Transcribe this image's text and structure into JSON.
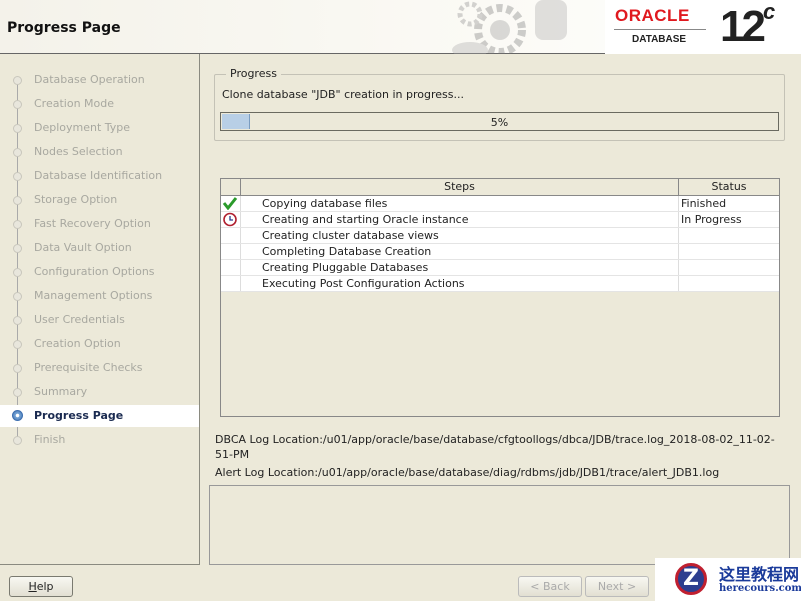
{
  "header": {
    "title": "Progress Page",
    "brand": "ORACLE",
    "product": "DATABASE",
    "version": "12",
    "version_suffix": "c"
  },
  "sidebar": {
    "items": [
      {
        "label": "Database Operation"
      },
      {
        "label": "Creation Mode"
      },
      {
        "label": "Deployment Type"
      },
      {
        "label": "Nodes Selection"
      },
      {
        "label": "Database Identification"
      },
      {
        "label": "Storage Option"
      },
      {
        "label": "Fast Recovery Option"
      },
      {
        "label": "Data Vault Option"
      },
      {
        "label": "Configuration Options"
      },
      {
        "label": "Management Options"
      },
      {
        "label": "User Credentials"
      },
      {
        "label": "Creation Option"
      },
      {
        "label": "Prerequisite Checks"
      },
      {
        "label": "Summary"
      },
      {
        "label": "Progress Page",
        "active": true
      },
      {
        "label": "Finish"
      }
    ]
  },
  "progress": {
    "group_label": "Progress",
    "message": "Clone database \"JDB\" creation in progress...",
    "percent": 5,
    "percent_label": "5%"
  },
  "steps_table": {
    "headers": [
      "Steps",
      "Status"
    ],
    "rows": [
      {
        "icon": "check-icon",
        "step": "Copying database files",
        "status": "Finished"
      },
      {
        "icon": "clock-icon",
        "step": "Creating and starting Oracle instance",
        "status": "In Progress"
      },
      {
        "icon": "",
        "step": "Creating cluster database views",
        "status": ""
      },
      {
        "icon": "",
        "step": "Completing Database Creation",
        "status": ""
      },
      {
        "icon": "",
        "step": "Creating Pluggable Databases",
        "status": ""
      },
      {
        "icon": "",
        "step": "Executing Post Configuration Actions",
        "status": ""
      }
    ]
  },
  "logs": {
    "dbca": "DBCA Log Location:/u01/app/oracle/base/database/cfgtoollogs/dbca/JDB/trace.log_2018-08-02_11-02-51-PM",
    "alert": "Alert Log Location:/u01/app/oracle/base/database/diag/rdbms/jdb/JDB1/trace/alert_JDB1.log"
  },
  "buttons": {
    "help": "Help",
    "back": "< Back",
    "next": "Next >"
  },
  "watermark": {
    "cn": "这里教程网",
    "en": "herecours.com"
  }
}
